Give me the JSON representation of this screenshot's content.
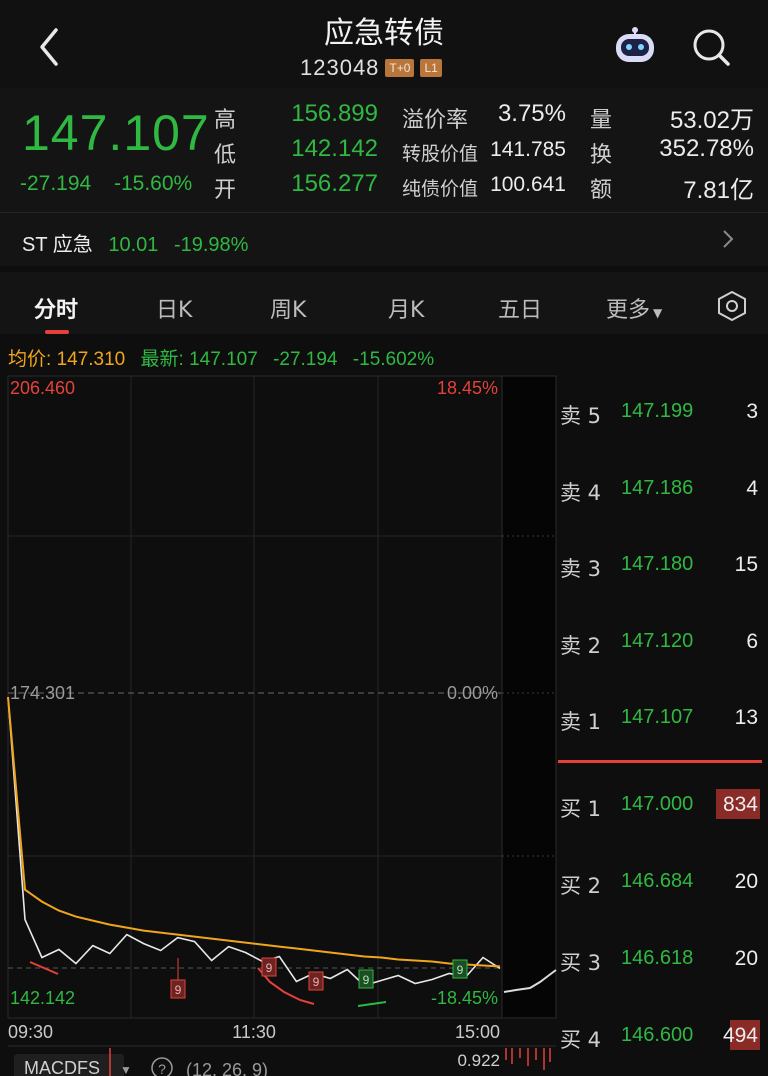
{
  "header": {
    "title": "应急转债",
    "code": "123048",
    "tags": [
      "T+0",
      "L1"
    ]
  },
  "quote": {
    "last": "147.107",
    "change": "-27.194",
    "change_pct": "-15.60%",
    "high_label": "高",
    "high": "156.899",
    "low_label": "低",
    "low": "142.142",
    "open_label": "开",
    "open": "156.277",
    "premium_label": "溢价率",
    "premium": "3.75%",
    "conv_value_label": "转股价值",
    "conv_value": "141.785",
    "bond_value_label": "纯债价值",
    "bond_value": "100.641",
    "volume_label": "量",
    "volume": "53.02万",
    "turnover_label": "换",
    "turnover": "352.78%",
    "amount_label": "额",
    "amount": "7.81亿"
  },
  "underlying": {
    "name": "ST 应急",
    "price": "10.01",
    "change_pct": "-19.98%"
  },
  "tabs": [
    "分时",
    "日K",
    "周K",
    "月K",
    "五日",
    "更多"
  ],
  "active_tab": "分时",
  "info_line": {
    "avg_label": "均价:",
    "avg": "147.310",
    "latest_label": "最新:",
    "latest": "147.107",
    "change": "-27.194",
    "change_pct": "-15.602%"
  },
  "chart_data": {
    "type": "line",
    "y_max": "206.460",
    "y_mid": "174.301",
    "y_min": "142.142",
    "pct_max": "18.45%",
    "pct_mid": "0.00%",
    "pct_min": "-18.45%",
    "time_labels": [
      "09:30",
      "11:30",
      "15:00"
    ],
    "ylim": [
      142.142,
      206.46
    ],
    "series": [
      {
        "values": [
          174.3,
          152.0,
          148.2,
          149.0,
          147.6,
          149.4,
          148.6,
          150.5,
          149.6,
          148.9,
          150.2,
          149.8,
          147.9,
          149.3,
          148.7,
          147.8,
          148.3,
          145.8,
          146.6,
          146.1,
          147.0,
          145.4,
          145.9,
          146.4,
          145.6,
          146.0,
          146.6,
          146.3,
          148.2,
          147.107
        ]
      },
      {
        "values": [
          174.3,
          155.0,
          153.8,
          152.9,
          152.3,
          151.9,
          151.5,
          151.2,
          150.9,
          150.7,
          150.5,
          150.3,
          150.1,
          149.9,
          149.7,
          149.5,
          149.3,
          149.1,
          148.9,
          148.7,
          148.5,
          148.3,
          148.2,
          148.0,
          147.9,
          147.8,
          147.6,
          147.5,
          147.4,
          147.31
        ]
      }
    ],
    "markers": [
      "9",
      "9",
      "9",
      "9",
      "9"
    ],
    "indicator_label": "MACDFS",
    "indicator_params": "(12, 26, 9)",
    "indicator_value": "0.922"
  },
  "orderbook": {
    "asks": [
      {
        "label": "卖 5",
        "price": "147.199",
        "vol": "3"
      },
      {
        "label": "卖 4",
        "price": "147.186",
        "vol": "4"
      },
      {
        "label": "卖 3",
        "price": "147.180",
        "vol": "15"
      },
      {
        "label": "卖 2",
        "price": "147.120",
        "vol": "6"
      },
      {
        "label": "卖 1",
        "price": "147.107",
        "vol": "13"
      }
    ],
    "bids": [
      {
        "label": "买 1",
        "price": "147.000",
        "vol": "834",
        "bar": 0.22
      },
      {
        "label": "买 2",
        "price": "146.684",
        "vol": "20"
      },
      {
        "label": "买 3",
        "price": "146.618",
        "vol": "20"
      },
      {
        "label": "买 4",
        "price": "146.600",
        "vol": "494",
        "bar": 0.15
      }
    ]
  },
  "colors": {
    "up": "#e5413a",
    "down": "#2fb842",
    "avg": "#f0a51c"
  }
}
